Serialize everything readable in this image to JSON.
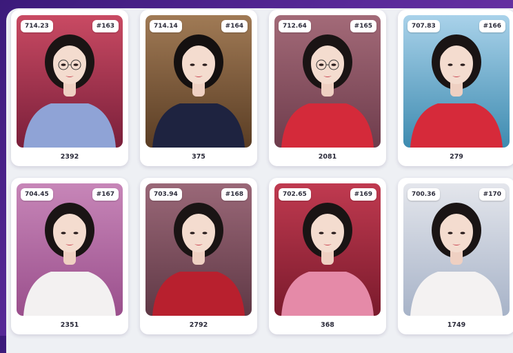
{
  "cards": [
    {
      "score": "714.23",
      "number": "#163",
      "count": "2392",
      "bg1": "#c94a63",
      "bg2": "#7a1f3a",
      "top": "#8fa3d6",
      "hair": "#1a1414",
      "glasses": true
    },
    {
      "score": "714.14",
      "number": "#164",
      "count": "375",
      "bg1": "#a07a55",
      "bg2": "#5a3d24",
      "top": "#1e2340",
      "hair": "#141010",
      "glasses": false
    },
    {
      "score": "712.64",
      "number": "#165",
      "count": "2081",
      "bg1": "#a36a78",
      "bg2": "#6e3c4c",
      "top": "#d42a3a",
      "hair": "#1a1414",
      "glasses": true
    },
    {
      "score": "707.83",
      "number": "#166",
      "count": "279",
      "bg1": "#a9d2ea",
      "bg2": "#3e8bb0",
      "top": "#d62a3a",
      "hair": "#1a1414",
      "glasses": false
    },
    {
      "score": "704.45",
      "number": "#167",
      "count": "2351",
      "bg1": "#c786b8",
      "bg2": "#9a4f8c",
      "top": "#f3f1f1",
      "hair": "#1a1414",
      "glasses": false
    },
    {
      "score": "703.94",
      "number": "#168",
      "count": "2792",
      "bg1": "#9a6878",
      "bg2": "#5f3845",
      "top": "#b8202e",
      "hair": "#1a1414",
      "glasses": false
    },
    {
      "score": "702.65",
      "number": "#169",
      "count": "368",
      "bg1": "#c03a50",
      "bg2": "#7a1a2c",
      "top": "#e58aa8",
      "hair": "#1a1414",
      "glasses": false
    },
    {
      "score": "700.36",
      "number": "#170",
      "count": "1749",
      "bg1": "#e4e6ec",
      "bg2": "#a7b3c8",
      "top": "#f4f2f2",
      "hair": "#1a1414",
      "glasses": false
    }
  ]
}
